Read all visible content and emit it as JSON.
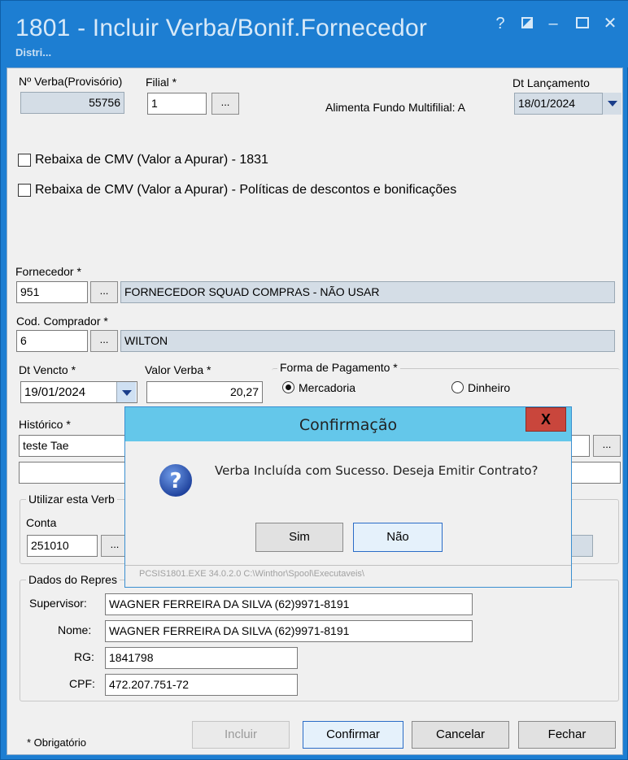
{
  "window": {
    "title": "1801 - Incluir Verba/Bonif.Fornecedor",
    "subtitle": "Distri...",
    "buttons": {
      "help": "?",
      "minimize": "–",
      "close": "✕"
    }
  },
  "form": {
    "nro_verba": {
      "label": "Nº Verba(Provisório)",
      "value": "55756"
    },
    "filial": {
      "label": "Filial *",
      "value": "1",
      "browse": "..."
    },
    "alimenta_fundo": {
      "label": "Alimenta Fundo Multifilial: A"
    },
    "dt_lancamento": {
      "label": "Dt Lançamento",
      "value": "18/01/2024"
    },
    "checkboxes": [
      {
        "label": "Rebaixa de CMV (Valor a Apurar) - 1831",
        "checked": false
      },
      {
        "label": "Rebaixa de CMV (Valor a Apurar) - Políticas de descontos e bonificações",
        "checked": false
      }
    ],
    "fornecedor": {
      "label": "Fornecedor *",
      "code": "951",
      "browse": "...",
      "name": "FORNECEDOR SQUAD COMPRAS - NÃO USAR"
    },
    "comprador": {
      "label": "Cod. Comprador *",
      "code": "6",
      "browse": "...",
      "name": "WILTON"
    },
    "dt_vencto": {
      "label": "Dt Vencto *",
      "value": "19/01/2024"
    },
    "valor_verba": {
      "label": "Valor Verba *",
      "value": "20,27"
    },
    "forma_pagamento": {
      "label": "Forma de Pagamento *",
      "options": [
        {
          "label": "Mercadoria",
          "selected": true
        },
        {
          "label": "Dinheiro",
          "selected": false
        }
      ]
    },
    "historico": {
      "label": "Histórico *",
      "value": "teste Tae",
      "value2": "",
      "browse": "..."
    },
    "utilizar": {
      "title": "Utilizar esta Verb",
      "conta_label": "Conta",
      "conta_value": "251010",
      "browse": "..."
    },
    "representante": {
      "title": "Dados do Repres",
      "supervisor": {
        "label": "Supervisor:",
        "value": "WAGNER FERREIRA DA SILVA (62)9971-8191"
      },
      "nome": {
        "label": "Nome:",
        "value": "WAGNER FERREIRA DA SILVA (62)9971-8191"
      },
      "rg": {
        "label": "RG:",
        "value": "1841798"
      },
      "cpf": {
        "label": "CPF:",
        "value": "472.207.751-72"
      }
    },
    "obrigatorio": "* Obrigatório"
  },
  "buttons": {
    "incluir": "Incluir",
    "confirmar": "Confirmar",
    "cancelar": "Cancelar",
    "fechar": "Fechar"
  },
  "dialog": {
    "title": "Confirmação",
    "close": "X",
    "message": "Verba Incluída com Sucesso. Deseja Emitir Contrato?",
    "yes": "Sim",
    "no": "Não",
    "status": "PCSIS1801.EXE 34.0.2.0 C:\\Winthor\\Spool\\Executaveis\\"
  },
  "colors": {
    "titlebar": "#1d7ed2",
    "dialog_title": "#64c7ea",
    "dialog_close": "#c9463c",
    "readonly_field": "#d4dde6"
  }
}
